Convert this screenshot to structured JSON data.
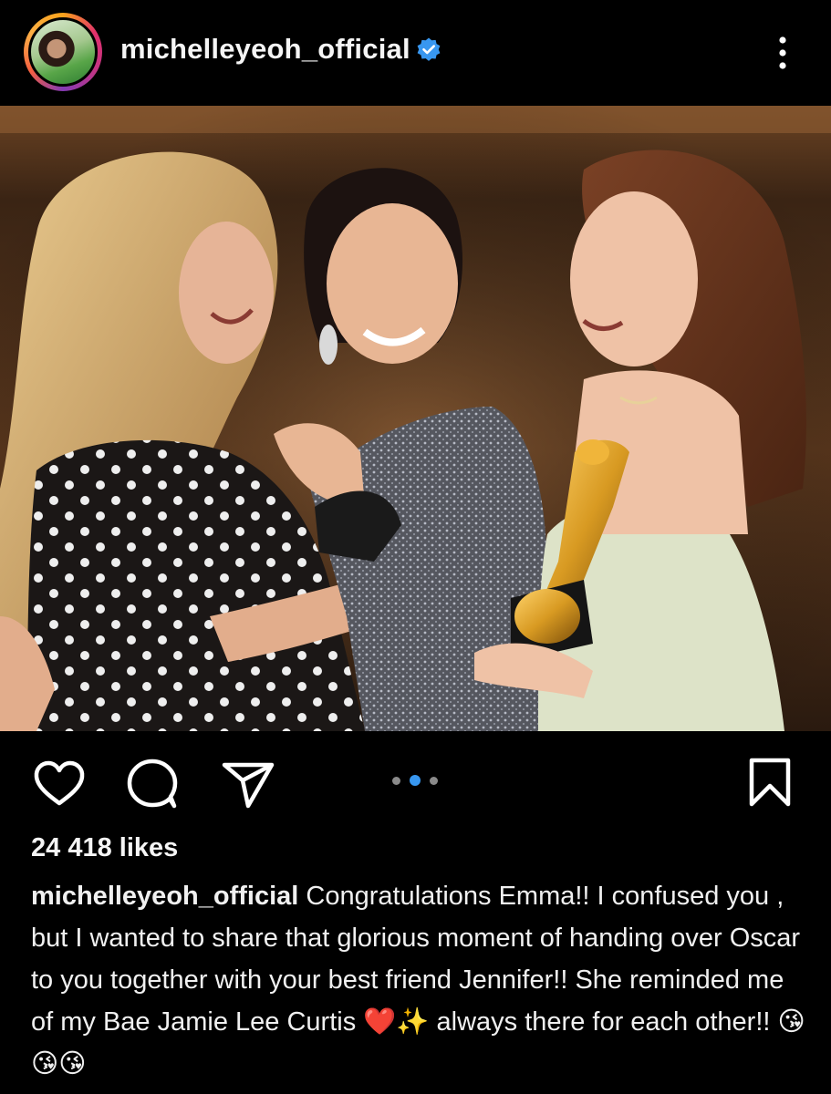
{
  "post": {
    "username": "michelleyeoh_official",
    "verified_icon": "verified-badge-icon",
    "more_icon": "more-vertical-icon",
    "likes": "24 418 likes",
    "caption_user": "michelleyeoh_official",
    "caption_text": "Congratulations Emma!! I confused you , but I wanted to share that glorious moment of handing over Oscar to you together with your best friend Jennifer!! She reminded me of my Bae Jamie Lee Curtis ❤️✨ always there for each other!! 😘😘😘",
    "carousel": {
      "count": 3,
      "active_index": 1
    },
    "colors": {
      "accent_blue": "#3897f0",
      "background": "#000000",
      "text": "#f5f5f5"
    }
  },
  "actions": {
    "like_icon": "heart-icon",
    "comment_icon": "comment-icon",
    "share_icon": "send-icon",
    "save_icon": "bookmark-icon"
  }
}
